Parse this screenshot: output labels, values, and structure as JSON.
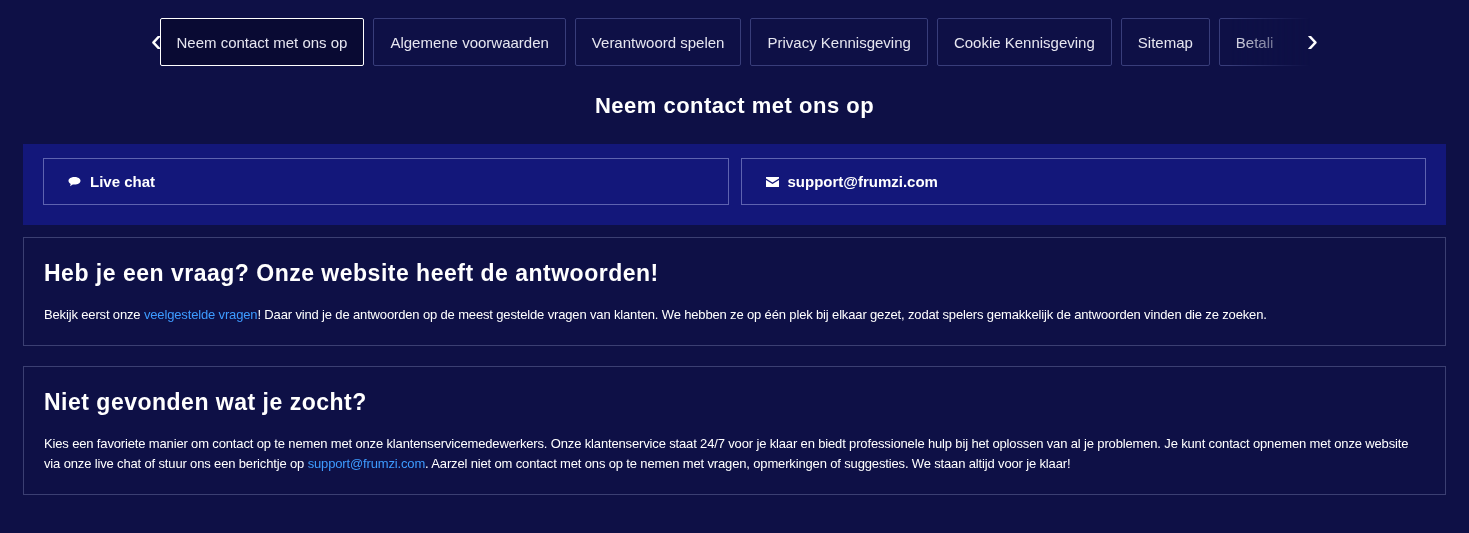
{
  "tabs": [
    {
      "label": "Neem contact met ons op",
      "selected": true
    },
    {
      "label": "Algemene voorwaarden",
      "selected": false
    },
    {
      "label": "Verantwoord spelen",
      "selected": false
    },
    {
      "label": "Privacy Kennisgeving",
      "selected": false
    },
    {
      "label": "Cookie Kennisgeving",
      "selected": false
    },
    {
      "label": "Sitemap",
      "selected": false
    },
    {
      "label": "Betali",
      "selected": false
    }
  ],
  "prev_arrow": "‹",
  "next_arrow": "›",
  "page_title": "Neem contact met ons op",
  "contact_options": [
    {
      "kind": "chat",
      "label": "Live chat"
    },
    {
      "kind": "email",
      "label": "support@frumzi.com"
    }
  ],
  "sections": [
    {
      "heading": "Heb je een vraag? Onze website heeft de antwoorden!",
      "text_before": "Bekijk eerst onze ",
      "link": "veelgestelde vragen",
      "text_after": "! Daar vind je de antwoorden op de meest gestelde vragen van klanten. We hebben ze op één plek bij elkaar gezet, zodat spelers gemakkelijk de antwoorden vinden die ze zoeken."
    },
    {
      "heading": "Niet gevonden wat je zocht?",
      "text_before": "Kies een favoriete manier om contact op te nemen met onze klantenservicemedewerkers. Onze klantenservice staat 24/7 voor je klaar en biedt professionele hulp bij het oplossen van al je problemen. Je kunt contact opnemen met onze website via onze live chat of stuur ons een berichtje op ",
      "link": "support@frumzi.com",
      "text_after": ". Aarzel niet om contact met ons op te nemen met vragen, opmerkingen of suggesties. We staan altijd voor je klaar!"
    }
  ]
}
